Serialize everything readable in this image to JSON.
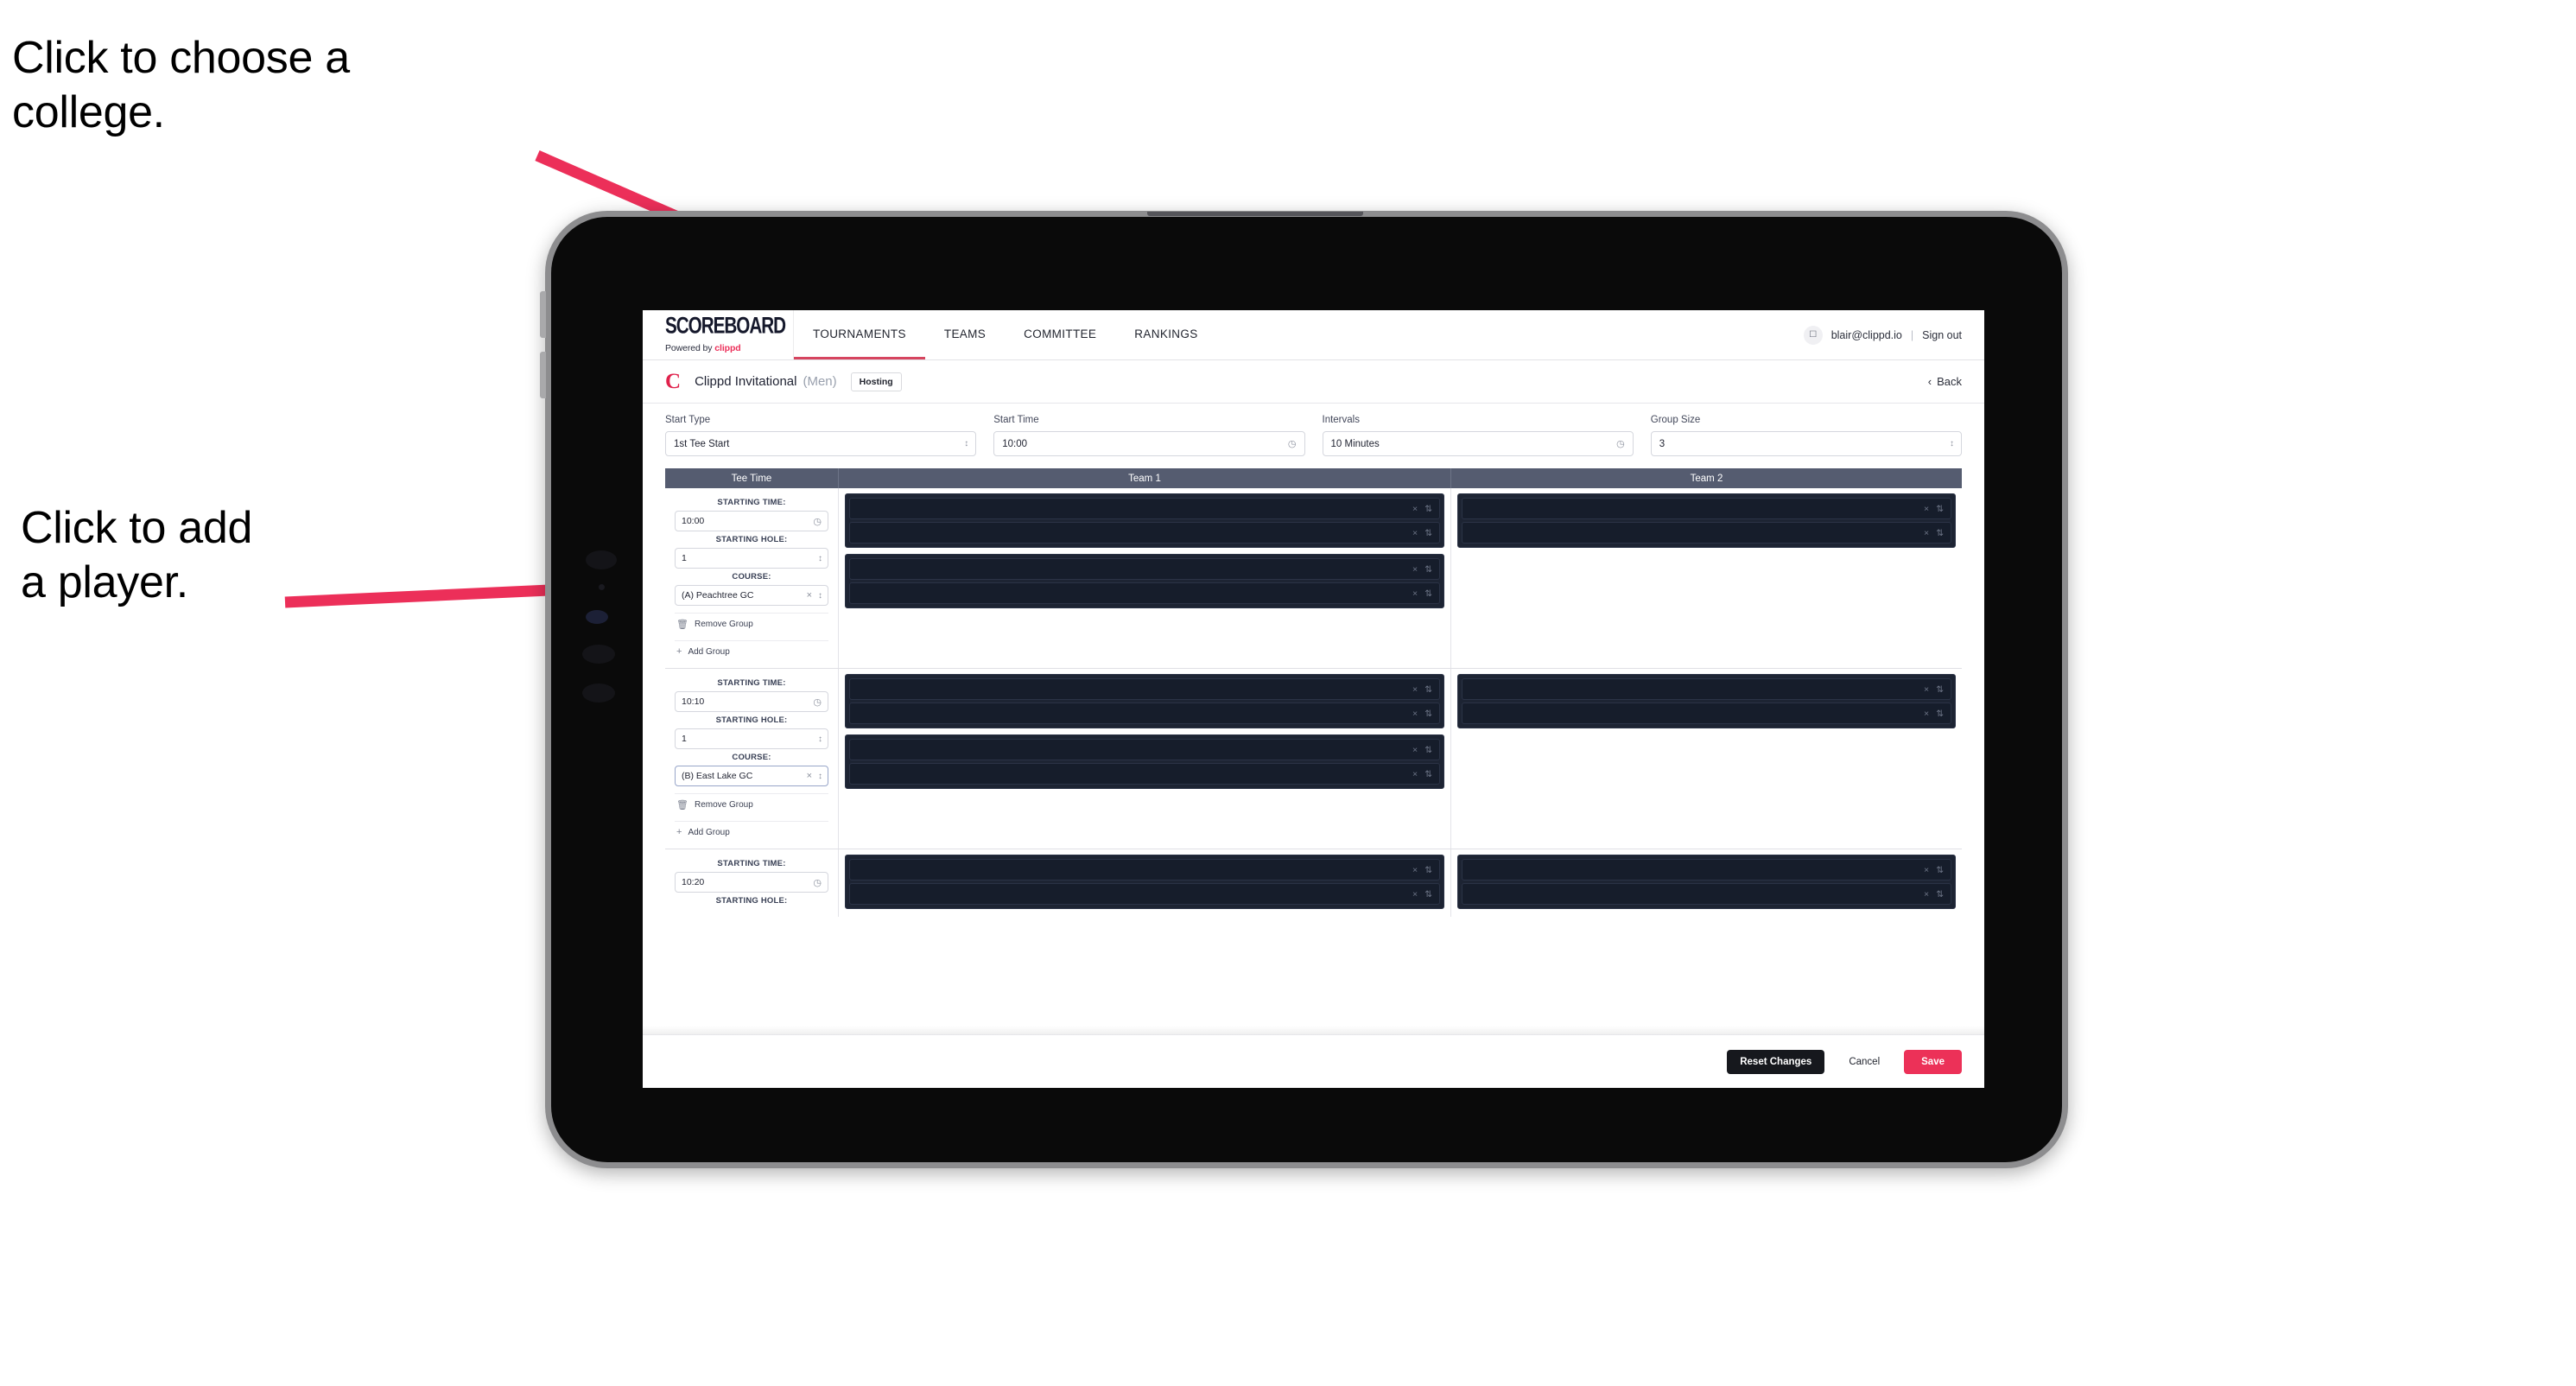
{
  "annotations": {
    "college": "Click to choose a\ncollege.",
    "player": "Click to add\na player.",
    "arrow_color": "#ec2f59"
  },
  "brand": {
    "wordmark": "SCOREBOARD",
    "powered_by_prefix": "Powered by ",
    "powered_by_name": "clippd"
  },
  "nav": {
    "tabs": [
      {
        "label": "TOURNAMENTS",
        "active": true
      },
      {
        "label": "TEAMS",
        "active": false
      },
      {
        "label": "COMMITTEE",
        "active": false
      },
      {
        "label": "RANKINGS",
        "active": false
      }
    ],
    "avatar_icon": "user-avatar-icon",
    "email": "blair@clippd.io",
    "separator": "|",
    "sign_out": "Sign out"
  },
  "tournament": {
    "logo_letter": "C",
    "name": "Clippd Invitational",
    "gender": "(Men)",
    "badge": "Hosting",
    "back_chevron": "‹",
    "back_label": "Back"
  },
  "settings": [
    {
      "label": "Start Type",
      "value": "1st Tee Start",
      "icon": "stepper-icon"
    },
    {
      "label": "Start Time",
      "value": "10:00",
      "icon": "clock-icon"
    },
    {
      "label": "Intervals",
      "value": "10 Minutes",
      "icon": "clock-icon"
    },
    {
      "label": "Group Size",
      "value": "3",
      "icon": "stepper-icon"
    }
  ],
  "table": {
    "headers": {
      "tee_time": "Tee Time",
      "team1": "Team 1",
      "team2": "Team 2"
    },
    "labels": {
      "starting_time": "STARTING TIME:",
      "starting_hole": "STARTING HOLE:",
      "course": "COURSE:",
      "remove_group": "Remove Group",
      "add_group": "Add Group"
    },
    "groups": [
      {
        "starting_time": "10:00",
        "starting_hole": "1",
        "course": "(A) Peachtree GC",
        "course_focused": false,
        "team1_blocks": [
          {
            "slots": 2
          },
          {
            "slots": 2
          }
        ],
        "team2_blocks": [
          {
            "slots": 2
          }
        ]
      },
      {
        "starting_time": "10:10",
        "starting_hole": "1",
        "course": "(B) East Lake GC",
        "course_focused": true,
        "team1_blocks": [
          {
            "slots": 2
          },
          {
            "slots": 2
          }
        ],
        "team2_blocks": [
          {
            "slots": 2
          }
        ]
      },
      {
        "starting_time": "10:20",
        "starting_hole": "",
        "course": "",
        "course_focused": false,
        "team1_blocks": [
          {
            "slots": 2
          }
        ],
        "team2_blocks": [
          {
            "slots": 2
          }
        ]
      }
    ],
    "slot_icons": {
      "clear": "×",
      "stepper": "⇅"
    }
  },
  "footer": {
    "reset": "Reset Changes",
    "cancel": "Cancel",
    "save": "Save"
  },
  "colors": {
    "accent_pink": "#ec3158",
    "header_slate": "#555c70",
    "slot_dark": "#1d2433"
  }
}
